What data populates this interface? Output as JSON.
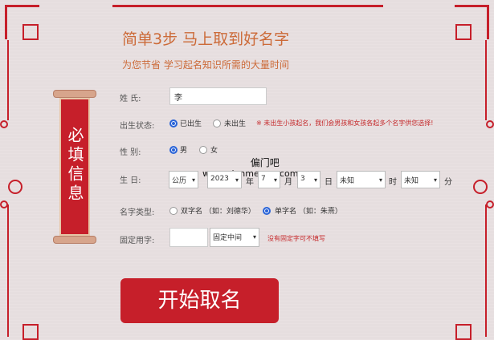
{
  "header": {
    "title": "简单3步 马上取到好名字",
    "subtitle": "为您节省 学习起名知识所需的大量时间"
  },
  "banner": {
    "text": "必填信息"
  },
  "form": {
    "surname": {
      "label": "姓    氏:",
      "value": "李"
    },
    "birth_status": {
      "label": "出生状态:",
      "options": [
        "已出生",
        "未出生"
      ],
      "selected": "已出生",
      "note": "※ 未出生小孩起名，我们会男孩和女孩各起多个名字供您选择!"
    },
    "gender": {
      "label": "性    别:",
      "options": [
        "男",
        "女"
      ],
      "selected": "男"
    },
    "birth_date": {
      "label": "生    日:",
      "calendar": "公历",
      "year": "2023",
      "year_unit": "年",
      "month": "7",
      "month_unit": "月",
      "day": "3",
      "day_unit": "日",
      "hour": "未知",
      "hour_unit": "时",
      "minute": "未知",
      "minute_unit": "分"
    },
    "name_type": {
      "label": "名字类型:",
      "options": [
        "双字名 （如：刘德华）",
        "单字名 （如：朱熹）"
      ],
      "selected": "单字名 （如：朱熹）"
    },
    "fixed_char": {
      "label": "固定用字:",
      "value": "",
      "position": "固定中间",
      "note": "没有固定字可不填写"
    }
  },
  "watermark": {
    "line1": "偏门吧",
    "line2": "www.pianmenwz.com"
  },
  "submit": {
    "label": "开始取名"
  },
  "colors": {
    "accent": "#c61f2a",
    "heading": "#cc6a38",
    "radio": "#2a64d8"
  }
}
